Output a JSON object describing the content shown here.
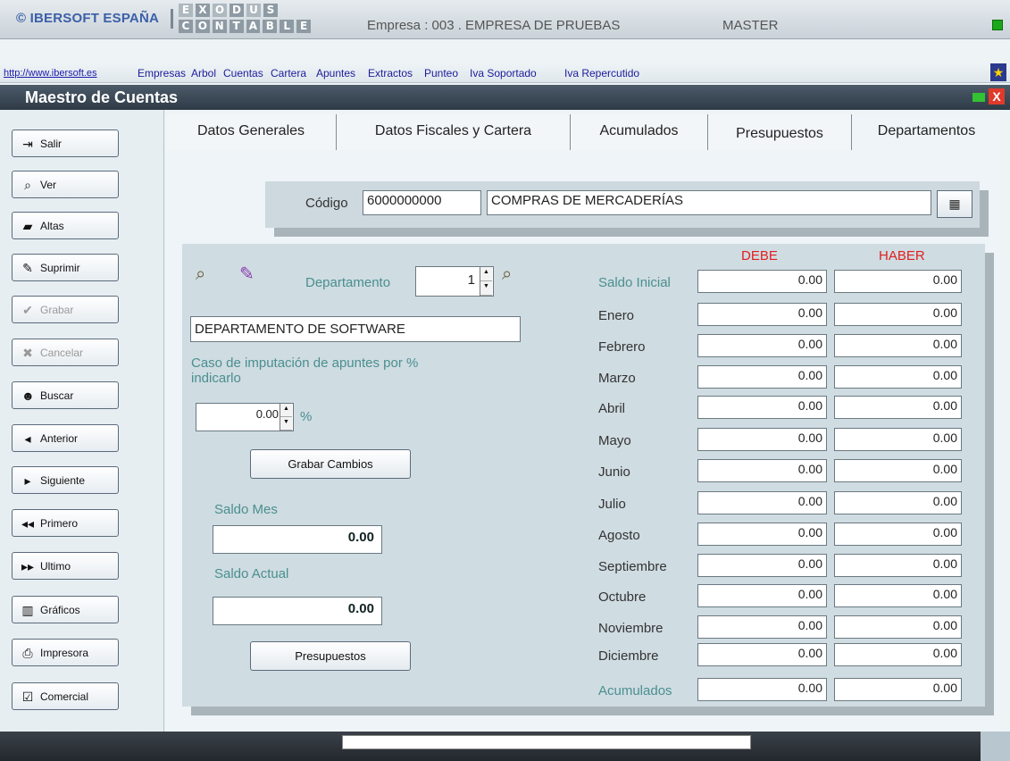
{
  "header": {
    "brand": "© IBERSOFT ESPAÑA",
    "logo_row1": [
      "E",
      "X",
      "O",
      "D",
      "U",
      "S"
    ],
    "logo_row2": [
      "C",
      "O",
      "N",
      "T",
      "A",
      "B",
      "L",
      "E"
    ],
    "company": "Empresa : 003 . EMPRESA DE PRUEBAS",
    "user": "MASTER"
  },
  "menu": {
    "url": "http://www.ibersoft.es",
    "items": [
      "Empresas",
      "Arbol",
      "Cuentas",
      "Cartera",
      "Apuntes",
      "Extractos",
      "Punteo",
      "Iva Soportado",
      "Iva Repercutido"
    ]
  },
  "window": {
    "title": "Maestro de Cuentas",
    "close": "X"
  },
  "sidebar": {
    "buttons": [
      {
        "label": "Salir",
        "icon": "exit-door-icon",
        "glyph": "⇥",
        "enabled": true
      },
      {
        "label": "Ver",
        "icon": "magnifier-icon",
        "glyph": "⌕",
        "enabled": true
      },
      {
        "label": "Altas",
        "icon": "open-folder-icon",
        "glyph": "▰",
        "enabled": true
      },
      {
        "label": "Suprimir",
        "icon": "eraser-icon",
        "glyph": "✎",
        "enabled": true
      },
      {
        "label": "Grabar",
        "icon": "checkmark-icon",
        "glyph": "✔",
        "enabled": false
      },
      {
        "label": "Cancelar",
        "icon": "cancel-x-icon",
        "glyph": "✖",
        "enabled": false
      },
      {
        "label": "Buscar",
        "icon": "people-search-icon",
        "glyph": "☻",
        "enabled": true
      },
      {
        "label": "Anterior",
        "icon": "arrow-left-icon",
        "glyph": "◂",
        "enabled": true
      },
      {
        "label": "Siguiente",
        "icon": "arrow-right-icon",
        "glyph": "▸",
        "enabled": true
      },
      {
        "label": "Primero",
        "icon": "double-arrow-left-icon",
        "glyph": "◂◂",
        "enabled": true
      },
      {
        "label": "Ultimo",
        "icon": "double-arrow-right-icon",
        "glyph": "▸▸",
        "enabled": true
      },
      {
        "label": "Gráficos",
        "icon": "bar-chart-icon",
        "glyph": "▥",
        "enabled": true
      },
      {
        "label": "Impresora",
        "icon": "printer-icon",
        "glyph": "⎙",
        "enabled": true
      },
      {
        "label": "Comercial",
        "icon": "commercial-icon",
        "glyph": "☑",
        "enabled": true
      }
    ]
  },
  "tabs": [
    "Datos Generales",
    "Datos Fiscales y Cartera",
    "Acumulados",
    "Presupuestos",
    "Departamentos"
  ],
  "active_tab": "Departamentos",
  "codigo": {
    "label": "Código",
    "code": "6000000000",
    "name": "COMPRAS DE MERCADERÍAS"
  },
  "departamento": {
    "label": "Departamento",
    "number": "1",
    "name": "DEPARTAMENTO DE SOFTWARE",
    "note_line1": "Caso de imputación de apuntes por %",
    "note_line2": "indicarlo",
    "percent": "0.00",
    "percent_sign": "%",
    "save_button": "Grabar Cambios",
    "saldo_mes_label": "Saldo Mes",
    "saldo_mes": "0.00",
    "saldo_actual_label": "Saldo Actual",
    "saldo_actual": "0.00",
    "presupuestos_button": "Presupuestos"
  },
  "ledger": {
    "debe_header": "DEBE",
    "haber_header": "HABER",
    "rows": [
      {
        "label": "Saldo Inicial",
        "debe": "0.00",
        "haber": "0.00"
      },
      {
        "label": "Enero",
        "debe": "0.00",
        "haber": "0.00"
      },
      {
        "label": "Febrero",
        "debe": "0.00",
        "haber": "0.00"
      },
      {
        "label": "Marzo",
        "debe": "0.00",
        "haber": "0.00"
      },
      {
        "label": "Abril",
        "debe": "0.00",
        "haber": "0.00"
      },
      {
        "label": "Mayo",
        "debe": "0.00",
        "haber": "0.00"
      },
      {
        "label": "Junio",
        "debe": "0.00",
        "haber": "0.00"
      },
      {
        "label": "Julio",
        "debe": "0.00",
        "haber": "0.00"
      },
      {
        "label": "Agosto",
        "debe": "0.00",
        "haber": "0.00"
      },
      {
        "label": "Septiembre",
        "debe": "0.00",
        "haber": "0.00"
      },
      {
        "label": "Octubre",
        "debe": "0.00",
        "haber": "0.00"
      },
      {
        "label": "Noviembre",
        "debe": "0.00",
        "haber": "0.00"
      },
      {
        "label": "Diciembre",
        "debe": "0.00",
        "haber": "0.00"
      },
      {
        "label": "Acumulados",
        "debe": "0.00",
        "haber": "0.00"
      }
    ]
  }
}
